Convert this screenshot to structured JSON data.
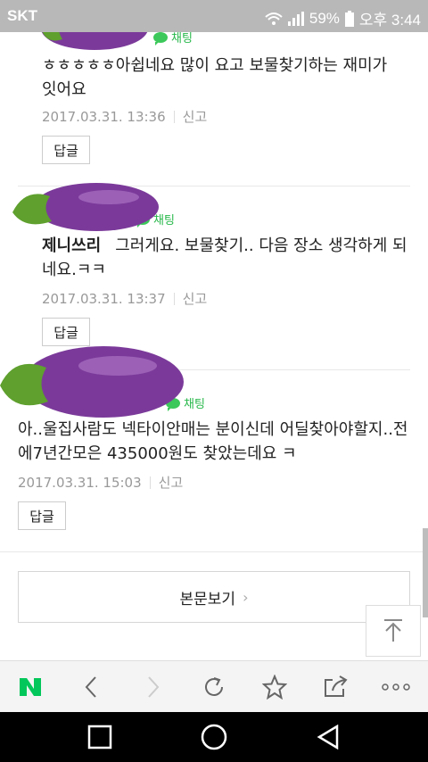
{
  "status_bar": {
    "carrier": "SKT",
    "battery": "59%",
    "time": "오후 3:44"
  },
  "comments": [
    {
      "badge": "채팅",
      "text": "ㅎㅎㅎㅎㅎ아쉽네요 많이 요고 보물찾기하는 재미가 잇어요",
      "date": "2017.03.31. 13:36",
      "report": "신고",
      "reply": "답글"
    },
    {
      "badge": "채팅",
      "author": "제니쓰리",
      "text": "그러게요. 보물찾기.. 다음 장소 생각하게 되네요.ㅋㅋ",
      "date": "2017.03.31. 13:37",
      "report": "신고",
      "reply": "답글"
    },
    {
      "badge": "채팅",
      "text": "아..울집사람도 넥타이안매는 분이신데 어딜찾아야할지..전에7년간모은 435000원도 찾았는데요 ㅋ",
      "date": "2017.03.31. 15:03",
      "report": "신고",
      "reply": "답글"
    }
  ],
  "full_view": {
    "label": "본문보기",
    "chevron": "›"
  },
  "browser_toolbar": [
    "naver-logo",
    "back-icon",
    "forward-icon",
    "refresh-icon",
    "bookmark-star-icon",
    "share-icon",
    "more-icon"
  ],
  "colors": {
    "status_bar": "#b8b8b8",
    "chat_green": "#27b84a",
    "naver_green": "#03c75a",
    "eggplant": "#7b3a9a"
  }
}
